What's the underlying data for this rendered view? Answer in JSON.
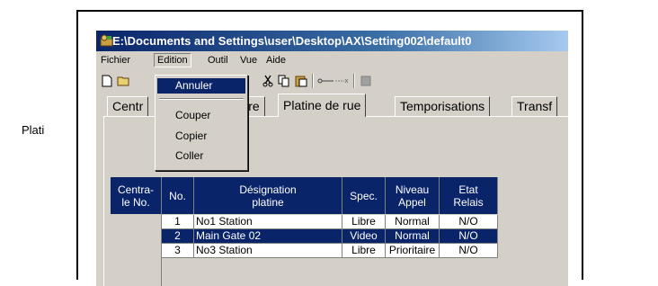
{
  "window": {
    "title": "E:\\Documents and Settings\\user\\Desktop\\AX\\Setting002\\default0"
  },
  "menubar": {
    "items": [
      "Fichier",
      "Edition",
      "Outil",
      "Vue",
      "Aide"
    ]
  },
  "edit_menu": {
    "items": [
      "Annuler",
      "Couper",
      "Copier",
      "Coller"
    ],
    "highlighted": "Annuler"
  },
  "toolbar": {
    "icons": [
      "new-icon",
      "open-icon",
      "cut-icon",
      "copy-icon",
      "paste-icon",
      "connect-icon",
      "record-icon"
    ]
  },
  "tabs": [
    "Centr",
    "Maître",
    "Platine de rue",
    "Temporisations",
    "Transf"
  ],
  "selected_tab": "Platine de rue",
  "panel": {
    "label": "Plati"
  },
  "table": {
    "columns": [
      "Centra-\nle No.",
      "No.",
      "Désignation\nplatine",
      "Spec.",
      "Niveau\nAppel",
      "Etat\nRelais"
    ],
    "rows": [
      {
        "no": "1",
        "designation": "No1 Station",
        "spec": "Libre",
        "niveau": "Normal",
        "etat": "N/O",
        "selected": false
      },
      {
        "no": "2",
        "designation": "Main Gate 02",
        "spec": "Video",
        "niveau": "Normal",
        "etat": "N/O",
        "selected": true
      },
      {
        "no": "3",
        "designation": "No3 Station",
        "spec": "Libre",
        "niveau": "Prioritaire",
        "etat": "N/O",
        "selected": false
      }
    ]
  },
  "colors": {
    "selection": "#0a246a",
    "face": "#d4d0c8"
  }
}
